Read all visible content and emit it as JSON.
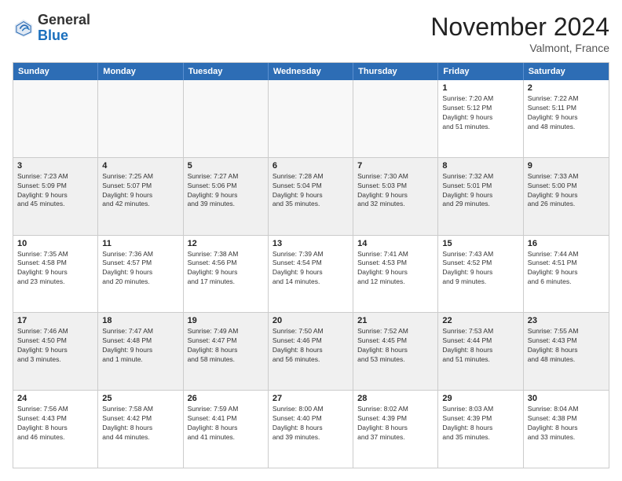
{
  "header": {
    "logo_general": "General",
    "logo_blue": "Blue",
    "month_title": "November 2024",
    "location": "Valmont, France"
  },
  "days_of_week": [
    "Sunday",
    "Monday",
    "Tuesday",
    "Wednesday",
    "Thursday",
    "Friday",
    "Saturday"
  ],
  "weeks": [
    [
      {
        "day": "",
        "info": "",
        "empty": true
      },
      {
        "day": "",
        "info": "",
        "empty": true
      },
      {
        "day": "",
        "info": "",
        "empty": true
      },
      {
        "day": "",
        "info": "",
        "empty": true
      },
      {
        "day": "",
        "info": "",
        "empty": true
      },
      {
        "day": "1",
        "info": "Sunrise: 7:20 AM\nSunset: 5:12 PM\nDaylight: 9 hours\nand 51 minutes."
      },
      {
        "day": "2",
        "info": "Sunrise: 7:22 AM\nSunset: 5:11 PM\nDaylight: 9 hours\nand 48 minutes."
      }
    ],
    [
      {
        "day": "3",
        "info": "Sunrise: 7:23 AM\nSunset: 5:09 PM\nDaylight: 9 hours\nand 45 minutes."
      },
      {
        "day": "4",
        "info": "Sunrise: 7:25 AM\nSunset: 5:07 PM\nDaylight: 9 hours\nand 42 minutes."
      },
      {
        "day": "5",
        "info": "Sunrise: 7:27 AM\nSunset: 5:06 PM\nDaylight: 9 hours\nand 39 minutes."
      },
      {
        "day": "6",
        "info": "Sunrise: 7:28 AM\nSunset: 5:04 PM\nDaylight: 9 hours\nand 35 minutes."
      },
      {
        "day": "7",
        "info": "Sunrise: 7:30 AM\nSunset: 5:03 PM\nDaylight: 9 hours\nand 32 minutes."
      },
      {
        "day": "8",
        "info": "Sunrise: 7:32 AM\nSunset: 5:01 PM\nDaylight: 9 hours\nand 29 minutes."
      },
      {
        "day": "9",
        "info": "Sunrise: 7:33 AM\nSunset: 5:00 PM\nDaylight: 9 hours\nand 26 minutes."
      }
    ],
    [
      {
        "day": "10",
        "info": "Sunrise: 7:35 AM\nSunset: 4:58 PM\nDaylight: 9 hours\nand 23 minutes."
      },
      {
        "day": "11",
        "info": "Sunrise: 7:36 AM\nSunset: 4:57 PM\nDaylight: 9 hours\nand 20 minutes."
      },
      {
        "day": "12",
        "info": "Sunrise: 7:38 AM\nSunset: 4:56 PM\nDaylight: 9 hours\nand 17 minutes."
      },
      {
        "day": "13",
        "info": "Sunrise: 7:39 AM\nSunset: 4:54 PM\nDaylight: 9 hours\nand 14 minutes."
      },
      {
        "day": "14",
        "info": "Sunrise: 7:41 AM\nSunset: 4:53 PM\nDaylight: 9 hours\nand 12 minutes."
      },
      {
        "day": "15",
        "info": "Sunrise: 7:43 AM\nSunset: 4:52 PM\nDaylight: 9 hours\nand 9 minutes."
      },
      {
        "day": "16",
        "info": "Sunrise: 7:44 AM\nSunset: 4:51 PM\nDaylight: 9 hours\nand 6 minutes."
      }
    ],
    [
      {
        "day": "17",
        "info": "Sunrise: 7:46 AM\nSunset: 4:50 PM\nDaylight: 9 hours\nand 3 minutes."
      },
      {
        "day": "18",
        "info": "Sunrise: 7:47 AM\nSunset: 4:48 PM\nDaylight: 9 hours\nand 1 minute."
      },
      {
        "day": "19",
        "info": "Sunrise: 7:49 AM\nSunset: 4:47 PM\nDaylight: 8 hours\nand 58 minutes."
      },
      {
        "day": "20",
        "info": "Sunrise: 7:50 AM\nSunset: 4:46 PM\nDaylight: 8 hours\nand 56 minutes."
      },
      {
        "day": "21",
        "info": "Sunrise: 7:52 AM\nSunset: 4:45 PM\nDaylight: 8 hours\nand 53 minutes."
      },
      {
        "day": "22",
        "info": "Sunrise: 7:53 AM\nSunset: 4:44 PM\nDaylight: 8 hours\nand 51 minutes."
      },
      {
        "day": "23",
        "info": "Sunrise: 7:55 AM\nSunset: 4:43 PM\nDaylight: 8 hours\nand 48 minutes."
      }
    ],
    [
      {
        "day": "24",
        "info": "Sunrise: 7:56 AM\nSunset: 4:43 PM\nDaylight: 8 hours\nand 46 minutes."
      },
      {
        "day": "25",
        "info": "Sunrise: 7:58 AM\nSunset: 4:42 PM\nDaylight: 8 hours\nand 44 minutes."
      },
      {
        "day": "26",
        "info": "Sunrise: 7:59 AM\nSunset: 4:41 PM\nDaylight: 8 hours\nand 41 minutes."
      },
      {
        "day": "27",
        "info": "Sunrise: 8:00 AM\nSunset: 4:40 PM\nDaylight: 8 hours\nand 39 minutes."
      },
      {
        "day": "28",
        "info": "Sunrise: 8:02 AM\nSunset: 4:39 PM\nDaylight: 8 hours\nand 37 minutes."
      },
      {
        "day": "29",
        "info": "Sunrise: 8:03 AM\nSunset: 4:39 PM\nDaylight: 8 hours\nand 35 minutes."
      },
      {
        "day": "30",
        "info": "Sunrise: 8:04 AM\nSunset: 4:38 PM\nDaylight: 8 hours\nand 33 minutes."
      }
    ]
  ]
}
